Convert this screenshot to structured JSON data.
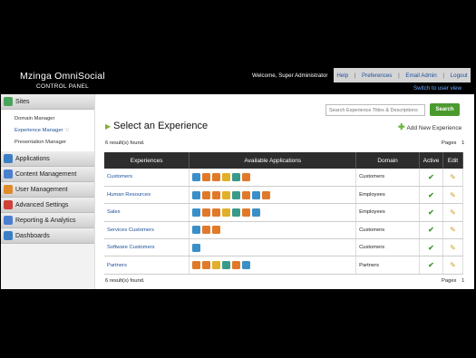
{
  "header": {
    "app_title": "Mzinga OmniSocial",
    "app_subtitle": "CONTROL PANEL",
    "welcome": "Welcome, Super Administrator",
    "nav": [
      "Help",
      "Preferences",
      "Email Admin",
      "Logout"
    ],
    "switch_user": "Switch to user view"
  },
  "sidebar": {
    "sections": [
      {
        "label": "Sites",
        "icon": "home-icon",
        "color": "#4aa35a"
      },
      {
        "label": "Applications",
        "icon": "applications-icon",
        "color": "#3a7fc4"
      },
      {
        "label": "Content Management",
        "icon": "content-icon",
        "color": "#4a7fd0"
      },
      {
        "label": "User Management",
        "icon": "user-icon",
        "color": "#e08a2a"
      },
      {
        "label": "Advanced Settings",
        "icon": "settings-icon",
        "color": "#d0413a"
      },
      {
        "label": "Reporting & Analytics",
        "icon": "reporting-icon",
        "color": "#4a7fd0"
      },
      {
        "label": "Dashboards",
        "icon": "dashboard-icon",
        "color": "#3a7fc4"
      }
    ],
    "site_items": [
      "Domain Manager",
      "Experience Manager",
      "Presentation Manager"
    ]
  },
  "main": {
    "search_placeholder": "Search Experience Titles & Descriptions",
    "search_button": "Search",
    "title": "Select an Experience",
    "add_new": "Add New Experience",
    "results_top": "6 result(s) found.",
    "results_bottom": "6 result(s) found.",
    "pages_label": "Pages",
    "pages_value": "1",
    "columns": [
      "Experiences",
      "Available Applications",
      "Domain",
      "Active",
      "Edit"
    ],
    "rows": [
      {
        "name": "Customers",
        "domain": "Customers",
        "apps": [
          "#3a8fc8",
          "#e07a2a",
          "#e07a2a",
          "#e0b02a",
          "#3a9a8a",
          "#e07a2a"
        ]
      },
      {
        "name": "Human Resources",
        "domain": "Employees",
        "apps": [
          "#3a8fc8",
          "#e07a2a",
          "#e07a2a",
          "#e0b02a",
          "#3a9a8a",
          "#e07a2a",
          "#3a8fc8",
          "#e07a2a"
        ]
      },
      {
        "name": "Sales",
        "domain": "Employees",
        "apps": [
          "#3a8fc8",
          "#e07a2a",
          "#e07a2a",
          "#e0b02a",
          "#3a9a8a",
          "#e07a2a",
          "#3a8fc8"
        ]
      },
      {
        "name": "Services Customers",
        "domain": "Customers",
        "apps": [
          "#3a8fc8",
          "#e07a2a",
          "#e07a2a"
        ]
      },
      {
        "name": "Software Customers",
        "domain": "Customers",
        "apps": [
          "#3a8fc8"
        ]
      },
      {
        "name": "Partners",
        "domain": "Partners",
        "apps": [
          "#e07a2a",
          "#e07a2a",
          "#e0b02a",
          "#3a9a8a",
          "#e07a2a",
          "#3a8fc8"
        ]
      }
    ]
  }
}
